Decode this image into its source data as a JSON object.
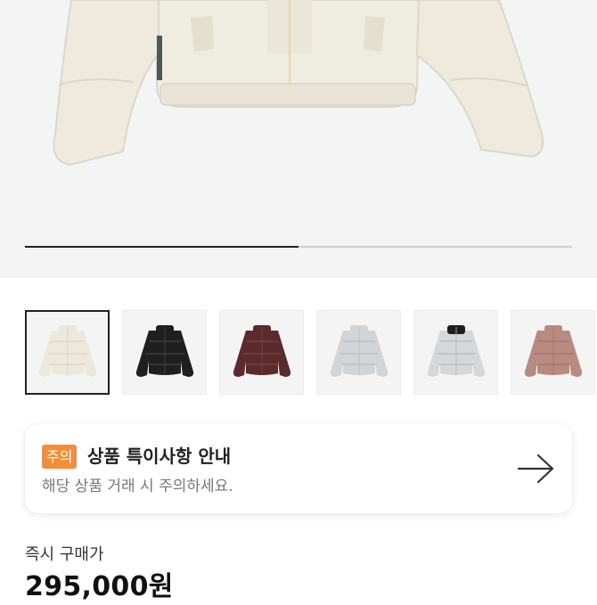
{
  "gallery": {
    "progress_fraction": 0.5,
    "thumbnails": [
      {
        "name": "cream",
        "body": "#ece9dc",
        "collar": "#ece9dc",
        "shade": "#d8d4c4",
        "selected": true
      },
      {
        "name": "black",
        "body": "#1f1f1f",
        "collar": "#1f1f1f",
        "shade": "#444444",
        "selected": false
      },
      {
        "name": "burgundy",
        "body": "#5a2a2c",
        "collar": "#5a2a2c",
        "shade": "#7a4446",
        "selected": false
      },
      {
        "name": "silver",
        "body": "#d2d5d8",
        "collar": "#d2d5d8",
        "shade": "#b8bcc0",
        "selected": false
      },
      {
        "name": "black-silver",
        "body": "#d6d7d9",
        "collar": "#1f1f1f",
        "shade": "#b5b7ba",
        "selected": false
      },
      {
        "name": "rose",
        "body": "#b98a80",
        "collar": "#b98a80",
        "shade": "#a57268",
        "selected": false
      }
    ]
  },
  "notice": {
    "badge": "주의",
    "title": "상품 특이사항 안내",
    "subtitle": "해당 상품 거래 시 주의하세요.",
    "arrow_icon": "arrow-right-icon"
  },
  "price": {
    "label": "즉시 구매가",
    "value": "295,000원"
  }
}
